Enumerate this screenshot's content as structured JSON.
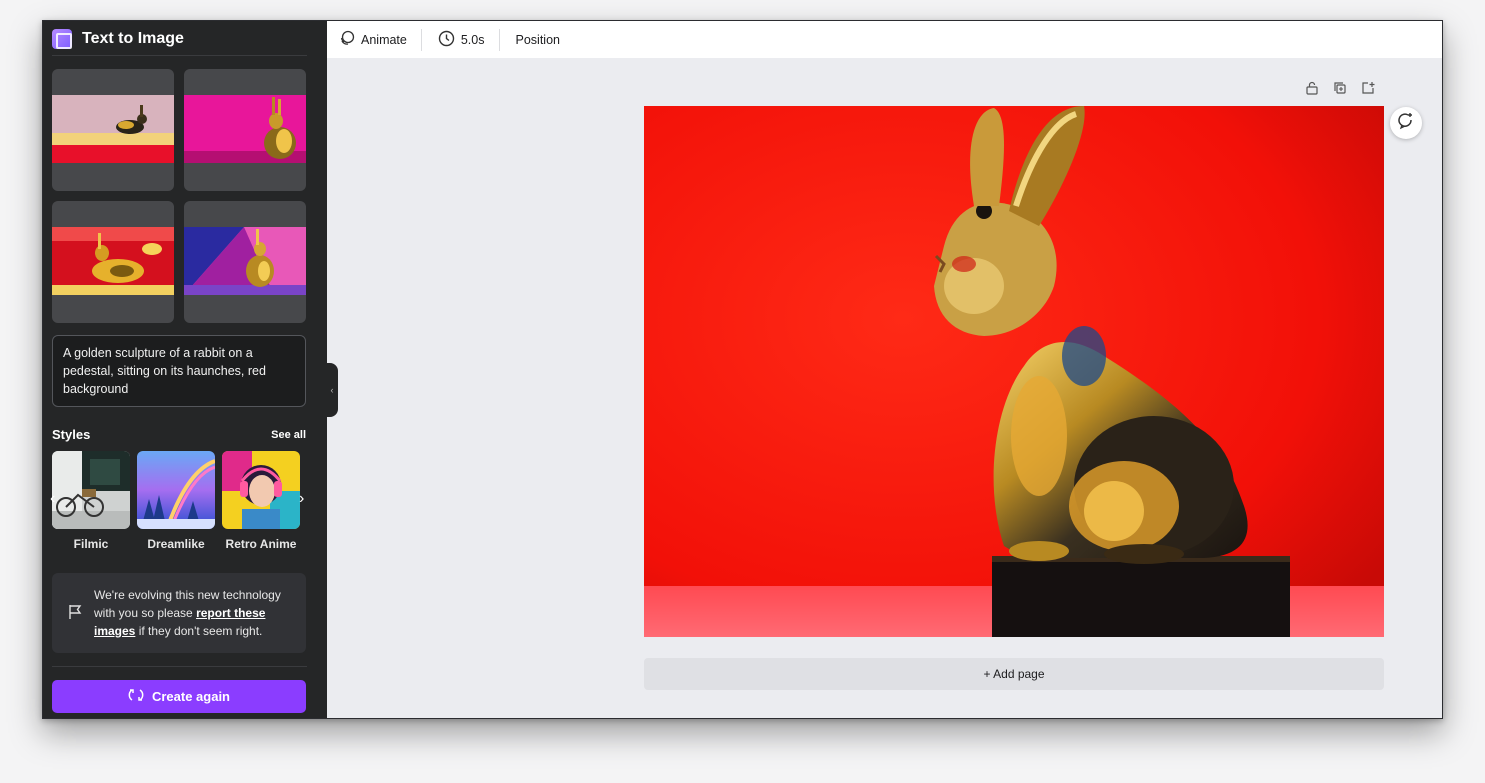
{
  "sidebar": {
    "title": "Text to Image",
    "prompt_text": "A golden sculpture of a rabbit on a pedestal, sitting on its haunches, red background",
    "styles_label": "Styles",
    "see_all_label": "See all",
    "styles": [
      {
        "name": "Filmic"
      },
      {
        "name": "Dreamlike"
      },
      {
        "name": "Retro Anime"
      }
    ],
    "notice": {
      "text_before": "We're evolving this new technology with you so please ",
      "link_text": "report these images",
      "text_after": " if they don't seem right."
    },
    "create_again_label": "Create again"
  },
  "toolbar": {
    "animate_label": "Animate",
    "duration_label": "5.0s",
    "position_label": "Position"
  },
  "canvas": {
    "add_page_label": "+ Add page"
  },
  "colors": {
    "accent": "#8b3dff",
    "sidebar_bg": "#252627",
    "canvas_bg": "#ebecf0",
    "image_red": "#ff1a10"
  },
  "icons": [
    "app-icon",
    "animate-icon",
    "clock-icon",
    "lock-icon",
    "duplicate-icon",
    "add-page-icon",
    "refresh-comment-icon",
    "flag-icon",
    "refresh-icon",
    "chevron-left-icon",
    "chevron-right-icon"
  ]
}
